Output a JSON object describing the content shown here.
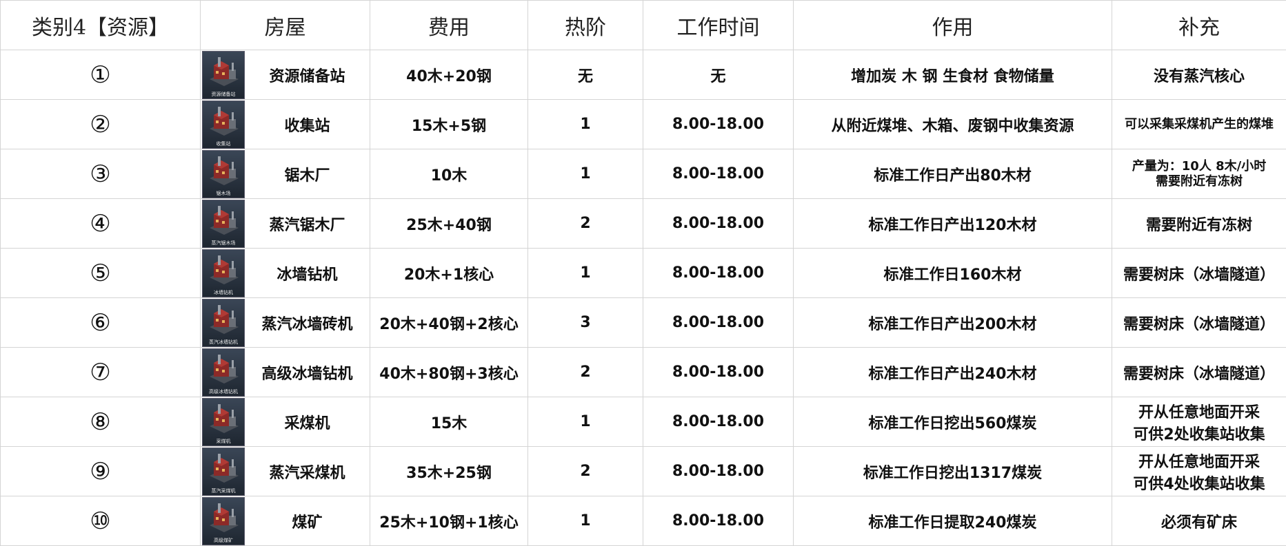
{
  "headers": [
    "类别4【资源】",
    "房屋",
    "费用",
    "热阶",
    "工作时间",
    "作用",
    "补充"
  ],
  "rows": [
    {
      "num": "①",
      "house": "资源储备站",
      "thumb_caption": "资源储备站",
      "cost": "40木+20钢",
      "heat": "无",
      "time": "无",
      "effect": "增加炭 木 钢  生食材 食物储量",
      "note": [
        "没有蒸汽核心"
      ]
    },
    {
      "num": "②",
      "house": "收集站",
      "thumb_caption": "收集站",
      "cost": "15木+5钢",
      "heat": "1",
      "time": "8.00-18.00",
      "effect": "从附近煤堆、木箱、废钢中收集资源",
      "note": [
        "可以采集采煤机产生的煤堆"
      ]
    },
    {
      "num": "③",
      "house": "锯木厂",
      "thumb_caption": "锯木场",
      "cost": "10木",
      "heat": "1",
      "time": "8.00-18.00",
      "effect": "标准工作日产出80木材",
      "note": [
        "产量为：10人 8木/小时",
        "需要附近有冻树"
      ]
    },
    {
      "num": "④",
      "house": "蒸汽锯木厂",
      "thumb_caption": "蒸汽锯木场",
      "cost": "25木+40钢",
      "heat": "2",
      "time": "8.00-18.00",
      "effect": "标准工作日产出120木材",
      "note": [
        "需要附近有冻树"
      ]
    },
    {
      "num": "⑤",
      "house": "冰墙钻机",
      "thumb_caption": "冰墙钻机",
      "cost": "20木+1核心",
      "heat": "1",
      "time": "8.00-18.00",
      "effect": "标准工作日160木材",
      "note": [
        "需要树床（冰墙隧道）"
      ]
    },
    {
      "num": "⑥",
      "house": "蒸汽冰墙砖机",
      "thumb_caption": "蒸汽冰墙钻机",
      "cost": "20木+40钢+2核心",
      "heat": "3",
      "time": "8.00-18.00",
      "effect": "标准工作日产出200木材",
      "note": [
        "需要树床（冰墙隧道）"
      ]
    },
    {
      "num": "⑦",
      "house": "高级冰墙钻机",
      "thumb_caption": "高级冰墙钻机",
      "cost": "40木+80钢+3核心",
      "heat": "2",
      "time": "8.00-18.00",
      "effect": "标准工作日产出240木材",
      "note": [
        "需要树床（冰墙隧道）"
      ]
    },
    {
      "num": "⑧",
      "house": "采煤机",
      "thumb_caption": "采煤机",
      "cost": "15木",
      "heat": "1",
      "time": "8.00-18.00",
      "effect": "标准工作日挖出560煤炭",
      "note": [
        "开从任意地面开采",
        "可供2处收集站收集"
      ]
    },
    {
      "num": "⑨",
      "house": "蒸汽采煤机",
      "thumb_caption": "蒸汽采煤机",
      "cost": "35木+25钢",
      "heat": "2",
      "time": "8.00-18.00",
      "effect": "标准工作日挖出1317煤炭",
      "note": [
        "开从任意地面开采",
        "可供4处收集站收集"
      ]
    },
    {
      "num": "⑩",
      "house": "煤矿",
      "thumb_caption": "高级煤矿",
      "cost": "25木+10钢+1核心",
      "heat": "1",
      "time": "8.00-18.00",
      "effect": "标准工作日提取240煤炭",
      "note": [
        "必须有矿床"
      ]
    }
  ]
}
